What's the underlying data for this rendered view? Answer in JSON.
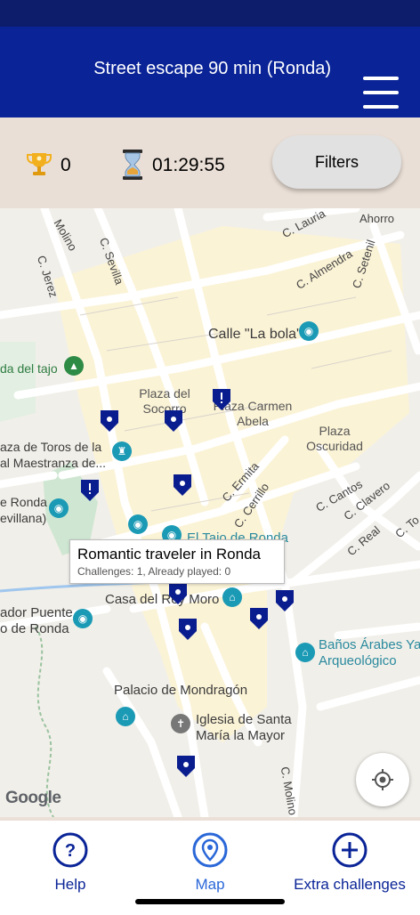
{
  "header": {
    "title": "Street escape 90 min (Ronda)",
    "menu_icon": "hamburger-menu-icon"
  },
  "info": {
    "score": "0",
    "timer": "01:29:55",
    "filters_label": "Filters",
    "score_icon": "trophy-icon",
    "timer_icon": "hourglass-icon"
  },
  "map": {
    "streets": [
      "Molino",
      "C. Jerez",
      "C. Sevilla",
      "C. Lauria",
      "Ahorro",
      "C. Almendra",
      "C. Setenil",
      "C. Ermita",
      "C. Cerrillo",
      "C. Cantos",
      "C. Clavero",
      "C. Real",
      "C. Molino d",
      "C. To"
    ],
    "pois": {
      "calle_la_bola": "Calle \"La bola\"",
      "alameda": "da del tajo",
      "plaza_toros_1": "aza de Toros de la",
      "plaza_toros_2": "al Maestranza de...",
      "de_ronda_1": "e Ronda",
      "de_ronda_2": "evillana)",
      "tajo_ronda": "El Tajo de Ronda",
      "casa_rey_moro": "Casa del Rey Moro",
      "puente_1": "ador Puente",
      "puente_2": "o de Ronda",
      "banos_1": "Baños Árabes Ya",
      "banos_2": "Arqueológico",
      "palacio": "Palacio de Mondragón",
      "iglesia_1": "Iglesia de Santa",
      "iglesia_2": "María la Mayor"
    },
    "places": {
      "plaza_socorro_1": "Plaza del",
      "plaza_socorro_2": "Socorro",
      "plaza_carmen_1": "Plaza Carmen",
      "plaza_carmen_2": "Abela",
      "plaza_oscuridad_1": "Plaza",
      "plaza_oscuridad_2": "Oscuridad"
    },
    "tooltip": {
      "title": "Romantic traveler in Ronda",
      "subtitle": "Challenges: 1, Already played: 0"
    },
    "google_logo": "Google",
    "locate_icon": "my-location-icon",
    "colors": {
      "marker": "#0a1d8f",
      "old_town": "#fbf3d6",
      "water": "#9fc6ee",
      "park": "#cfe7d2"
    }
  },
  "tabs": [
    {
      "label": "Help",
      "icon": "help-icon"
    },
    {
      "label": "Map",
      "icon": "map-pin-icon",
      "active": true
    },
    {
      "label": "Extra challenges",
      "icon": "plus-circle-icon"
    }
  ]
}
